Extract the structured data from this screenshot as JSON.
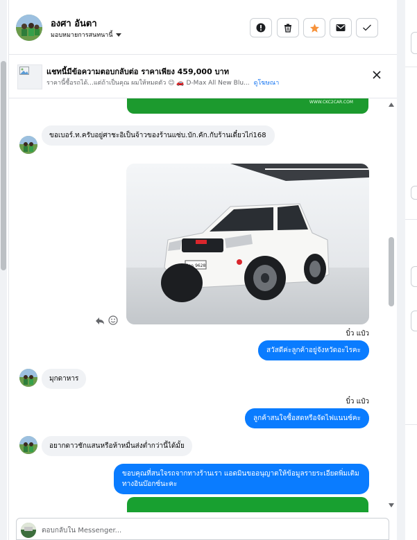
{
  "contact": {
    "name": "องศา อันตา",
    "assign_label": "มอบหมายการสนทนานี้"
  },
  "actions": [
    {
      "name": "mark-spam-button",
      "icon": "alert-icon"
    },
    {
      "name": "delete-button",
      "icon": "trash-icon"
    },
    {
      "name": "star-button",
      "icon": "star-icon"
    },
    {
      "name": "mark-unread-button",
      "icon": "envelope-icon"
    },
    {
      "name": "mark-done-button",
      "icon": "check-icon"
    }
  ],
  "ad": {
    "title": "แชทนี้มีข้อความตอบกลับต่อ ราคาเพียง 459,000 บาท",
    "subtitle": "ราคานี้ซื้อรถได้...แต่ถ้าเป็นคุณ ผมให้หมดตัว 😉 🚗 D-Max All New Blu...",
    "link": "ดูโฆษณา"
  },
  "banner_text": "WWW.CKC2CAR.COM",
  "messages": {
    "m1": "ขอเบอร์.ท.ครับอยู่ศาชะอิเป็นจ้าวของร้านแซ่บ.บัก.คัก.กับร้านเดี๋ยวไก่168",
    "sender1": "บิ๋ว แป๋ว",
    "m2": "สวัสดีค่ะลูกค้าอยู่จังหวัดอะไรคะ",
    "m3": "มุกดาหาร",
    "sender2": "บิ๋ว แป๋ว",
    "m4": "ลูกค้าสนใจซื้อสดหรือจัดไฟแนนซ์คะ",
    "m5": "อยากดาวชักแสนหรือห้าหมื่นส่งต่ำกว่านี้ได้มั้ย",
    "m6": "ขอบคุณที่สนใจรถจากทางร้านเรา แอดมินขออนุญาตให้ข้อมูลรายระเอียดพิ่มเติม ทางอินบ๊อกซ์นะคะ"
  },
  "truck_plate": "8กฉ 9628",
  "composer": {
    "placeholder": "ตอบกลับใน Messenger..."
  },
  "colors": {
    "outgoing": "#0a7cff",
    "incoming": "#f0f2f5",
    "star": "#f7923a",
    "banner_green": "#1c9a2e"
  }
}
